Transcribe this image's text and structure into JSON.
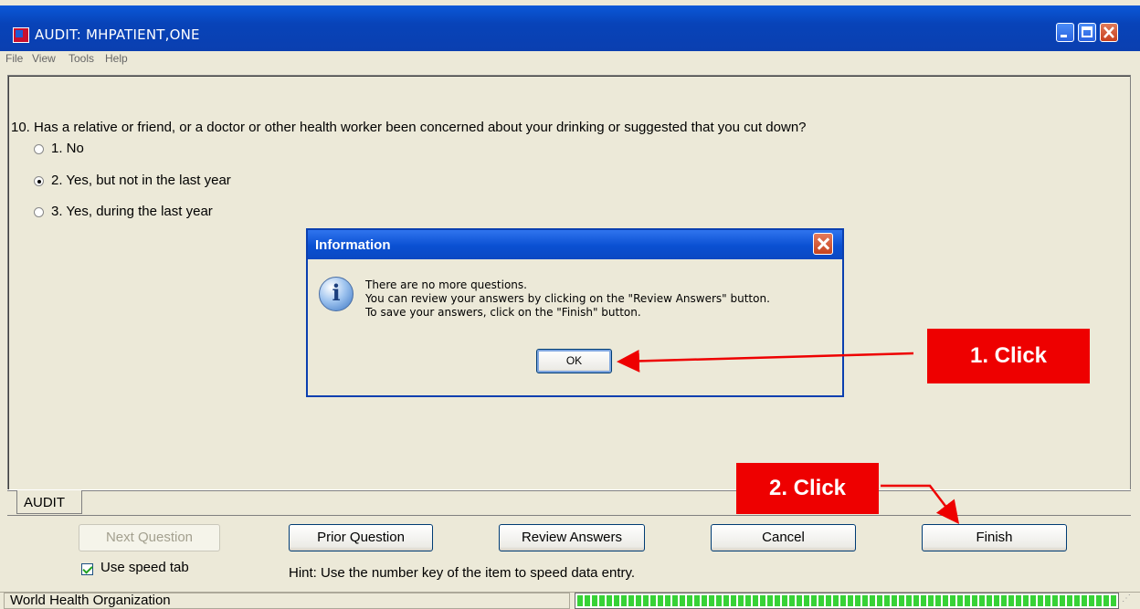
{
  "window": {
    "title": "AUDIT: MHPATIENT,ONE",
    "menu": [
      "File",
      "View",
      "Tools",
      "Help"
    ]
  },
  "question": {
    "text": "10. Has a relative or friend, or a doctor or other health worker been concerned about your drinking or suggested that you cut down?",
    "options": [
      {
        "label": "1. No",
        "selected": false
      },
      {
        "label": "2. Yes, but not in the last year",
        "selected": true
      },
      {
        "label": "3. Yes, during the last year",
        "selected": false
      }
    ]
  },
  "dialog": {
    "title": "Information",
    "icon": "info-icon",
    "icon_glyph": "i",
    "lines": [
      "There are no more questions.",
      "You can review your answers by clicking on the \"Review Answers\" button.",
      "To save your answers, click on the \"Finish\" button."
    ],
    "ok_label": "OK"
  },
  "tab": {
    "label": "AUDIT"
  },
  "buttons": {
    "next": "Next Question",
    "prior": "Prior Question",
    "review": "Review Answers",
    "cancel": "Cancel",
    "finish": "Finish"
  },
  "speed_tab": {
    "label": "Use speed tab",
    "checked": true
  },
  "hint": "Hint: Use the number key of the item to speed data entry.",
  "status": {
    "text": "World Health Organization",
    "progress": 1.0
  },
  "callouts": {
    "first": "1. Click",
    "second": "2. Click"
  },
  "colors": {
    "callout": "#ee0000",
    "titlebar": "#0a50d2",
    "progress": "#37d236"
  }
}
